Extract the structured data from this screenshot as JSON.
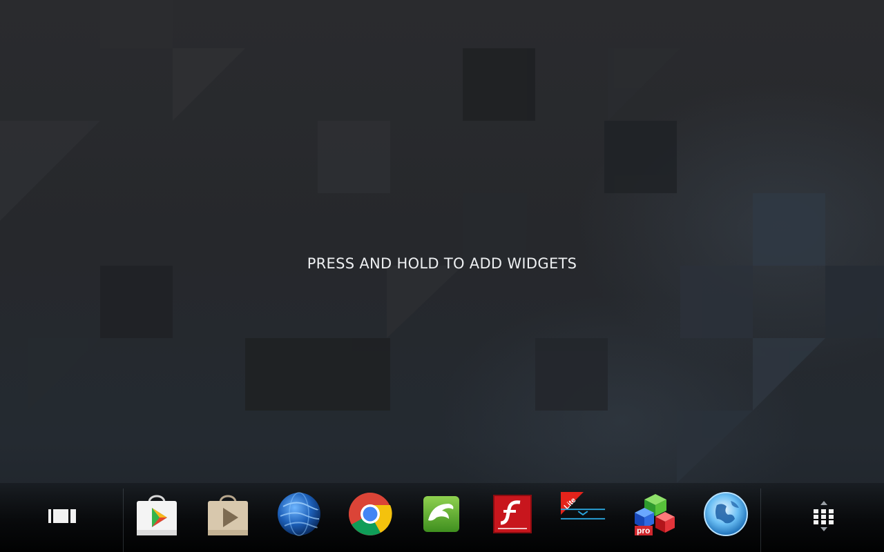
{
  "workspace": {
    "hint": "PRESS AND HOLD TO ADD WIDGETS"
  },
  "dock": {
    "left_button_icon": "recent-apps-icon",
    "right_button_icon": "all-apps-grid-icon",
    "apps": [
      {
        "name": "play-store",
        "icon": "play-store-bag-icon"
      },
      {
        "name": "play-movies",
        "icon": "play-bag-tan-icon"
      },
      {
        "name": "globe-browser",
        "icon": "globe-icon"
      },
      {
        "name": "chrome",
        "icon": "chrome-icon"
      },
      {
        "name": "dolphin-browser",
        "icon": "dolphin-icon"
      },
      {
        "name": "flash-player",
        "icon": "flash-icon"
      },
      {
        "name": "lite-app",
        "icon": "lite-download-icon",
        "badge": "Lite"
      },
      {
        "name": "office-suite-pro",
        "icon": "office-cubes-icon",
        "badge": "pro"
      },
      {
        "name": "web-globe",
        "icon": "blue-globe-icon"
      }
    ]
  }
}
